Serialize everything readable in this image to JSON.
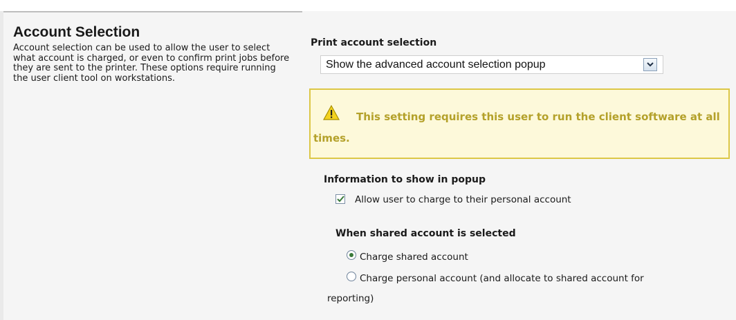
{
  "section": {
    "title": "Account Selection",
    "description": "Account selection can be used to allow the user to select what account is charged, or even to confirm print jobs before they are sent to the printer. These options require running the user client tool on workstations."
  },
  "print_account_selection": {
    "label": "Print account selection",
    "selected_value": "Show the advanced account selection popup"
  },
  "warning": {
    "icon": "warning-icon",
    "text": "This setting requires this user to run the client software at all times."
  },
  "popup_info": {
    "heading": "Information to show in popup",
    "personal_account_option": {
      "label": "Allow user to charge to their personal account",
      "checked": true
    }
  },
  "shared_account": {
    "heading": "When shared account is selected",
    "options": [
      {
        "label": "Charge shared account",
        "selected": true
      },
      {
        "label": "Charge personal account (and allocate to shared account for",
        "label_continued": "reporting)",
        "selected": false
      }
    ]
  },
  "colors": {
    "panel_background": "#f5f5f5",
    "warning_background": "#fdf9da",
    "warning_border": "#dcc746",
    "warning_text": "#b4a12a",
    "check_green": "#3a7a3a"
  }
}
